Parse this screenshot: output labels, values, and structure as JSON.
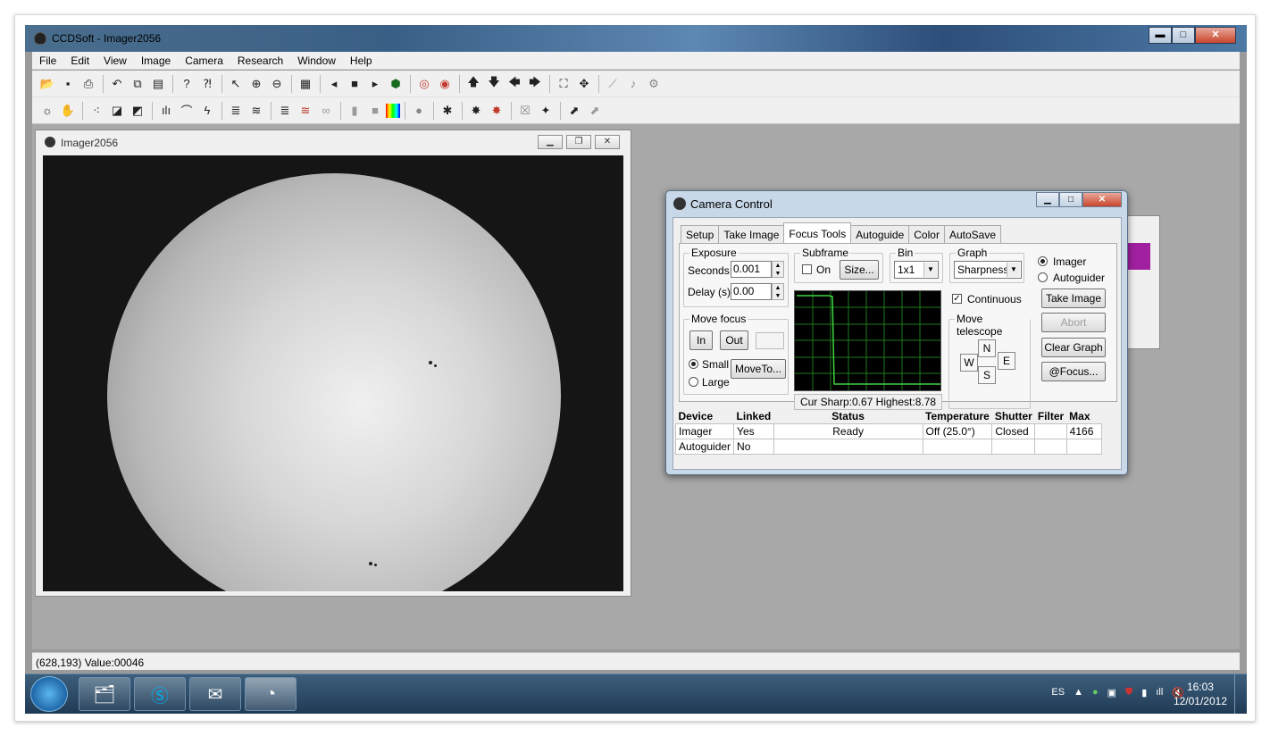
{
  "app": {
    "title": "CCDSoft  - Imager2056"
  },
  "menu": [
    "File",
    "Edit",
    "View",
    "Image",
    "Camera",
    "Research",
    "Window",
    "Help"
  ],
  "window_buttons": {
    "minimize": "▬",
    "maximize": "□",
    "close": "✕"
  },
  "child_window": {
    "title": "Imager2056"
  },
  "statusbar": {
    "text": "(628,193) Value:00046"
  },
  "camera_control": {
    "title": "Camera Control",
    "tabs": [
      "Setup",
      "Take Image",
      "Focus Tools",
      "Autoguide",
      "Color",
      "AutoSave"
    ],
    "active_tab": "Focus Tools",
    "exposure": {
      "legend": "Exposure",
      "seconds_label": "Seconds:",
      "seconds_value": "0.001",
      "delay_label": "Delay (s):",
      "delay_value": "0.00"
    },
    "subframe": {
      "legend": "Subframe",
      "on_label": "On",
      "size_button": "Size..."
    },
    "bin": {
      "legend": "Bin",
      "value": "1x1"
    },
    "graph": {
      "legend": "Graph",
      "value": "Sharpness"
    },
    "target": {
      "imager_label": "Imager",
      "autoguider_label": "Autoguider"
    },
    "move_focus": {
      "legend": "Move focus",
      "in_button": "In",
      "out_button": "Out",
      "small_label": "Small",
      "large_label": "Large",
      "moveto_button": "MoveTo..."
    },
    "continuous_label": "Continuous",
    "move_telescope": {
      "legend": "Move telescope",
      "n": "N",
      "s": "S",
      "e": "E",
      "w": "W"
    },
    "buttons": {
      "take_image": "Take Image",
      "abort": "Abort",
      "clear_graph": "Clear Graph",
      "at_focus": "@Focus..."
    },
    "sharpness_readout": "Cur Sharp:0.67 Highest:8.78",
    "device_table": {
      "headers": [
        "Device",
        "Linked",
        "Status",
        "Temperature",
        "Shutter",
        "Filter",
        "Max"
      ],
      "rows": [
        [
          "Imager",
          "Yes",
          "Ready",
          "Off (25.0°)",
          "Closed",
          "",
          "4166"
        ],
        [
          "Autoguider",
          "No",
          "",
          "",
          "",
          "",
          ""
        ]
      ]
    }
  },
  "taskbar": {
    "language": "ES",
    "time": "16:03",
    "date": "12/01/2012"
  },
  "colors": {
    "graph_line": "#3fd43f",
    "graph_grid": "#1f7a1f",
    "accent_purple": "#a020a0"
  }
}
